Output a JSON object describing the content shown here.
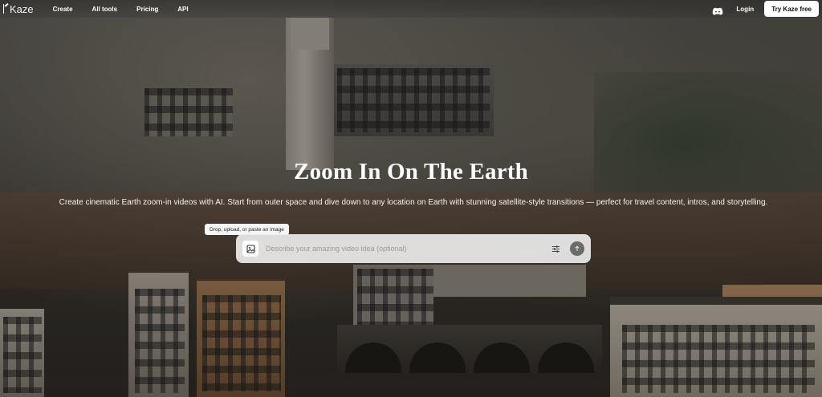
{
  "nav": {
    "logo": "Kaze",
    "links": [
      "Create",
      "All tools",
      "Pricing",
      "API"
    ],
    "login": "Login",
    "cta": "Try Kaze free",
    "discord_icon": "discord-icon"
  },
  "hero": {
    "title": "Zoom In On The Earth",
    "subtitle": "Create cinematic Earth zoom-in videos with AI. Start from outer space and dive down to any location on Earth with stunning satellite-style transitions — perfect for travel content, intros, and storytelling."
  },
  "prompt": {
    "tooltip": "Drop, upload, or paste an image",
    "placeholder": "Describe your amazing video idea (optional)",
    "icons": {
      "image": "image-upload-icon",
      "settings": "sliders-icon",
      "send": "arrow-up-icon"
    }
  },
  "colors": {
    "cta_bg": "#ffffff",
    "prompt_bg": "#ebebeb",
    "send_bg": "#6b6b6b"
  }
}
